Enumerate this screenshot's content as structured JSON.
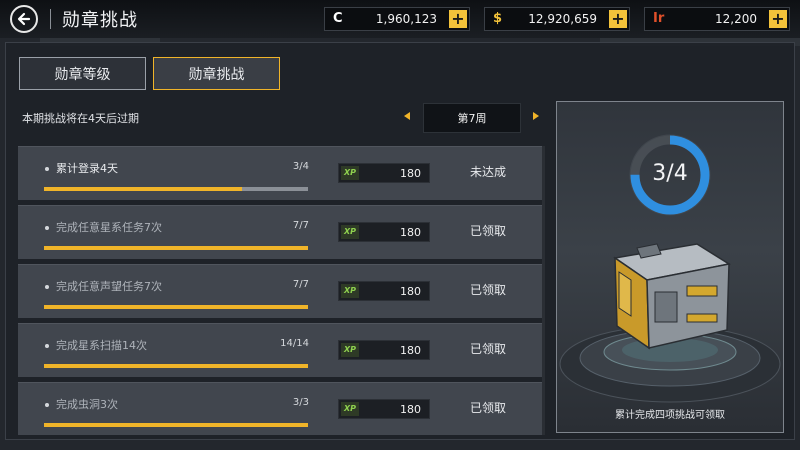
{
  "header": {
    "title": "勋章挑战",
    "currencies": [
      {
        "icon": "C",
        "icon_color": "#ffffff",
        "value": "1,960,123"
      },
      {
        "icon": "$",
        "icon_color": "#f3c23a",
        "value": "12,920,659"
      },
      {
        "icon": "Ir",
        "icon_color": "#e0502a",
        "value": "12,200"
      }
    ]
  },
  "tabs": [
    {
      "label": "勋章等级",
      "active": false
    },
    {
      "label": "勋章挑战",
      "active": true
    }
  ],
  "challenge": {
    "expire_text": "本期挑战将在4天后过期",
    "week_label": "第7周"
  },
  "tasks": [
    {
      "label": "累计登录4天",
      "progress": "3/4",
      "fraction": 0.75,
      "xp_icon": "XP",
      "xp": "180",
      "status": "未达成",
      "done": false
    },
    {
      "label": "完成任意星系任务7次",
      "progress": "7/7",
      "fraction": 1.0,
      "xp_icon": "XP",
      "xp": "180",
      "status": "已领取",
      "done": true
    },
    {
      "label": "完成任意声望任务7次",
      "progress": "7/7",
      "fraction": 1.0,
      "xp_icon": "XP",
      "xp": "180",
      "status": "已领取",
      "done": true
    },
    {
      "label": "完成星系扫描14次",
      "progress": "14/14",
      "fraction": 1.0,
      "xp_icon": "XP",
      "xp": "180",
      "status": "已领取",
      "done": true
    },
    {
      "label": "完成虫洞3次",
      "progress": "3/3",
      "fraction": 1.0,
      "xp_icon": "XP",
      "xp": "180",
      "status": "已领取",
      "done": true
    }
  ],
  "reward": {
    "ring_text": "3/4",
    "ring_fraction": 0.75,
    "caption": "累计完成四项挑战可领取"
  },
  "colors": {
    "accent": "#f0b429",
    "ring_blue": "#2f8fe0",
    "xp_green": "#8fd14f"
  }
}
